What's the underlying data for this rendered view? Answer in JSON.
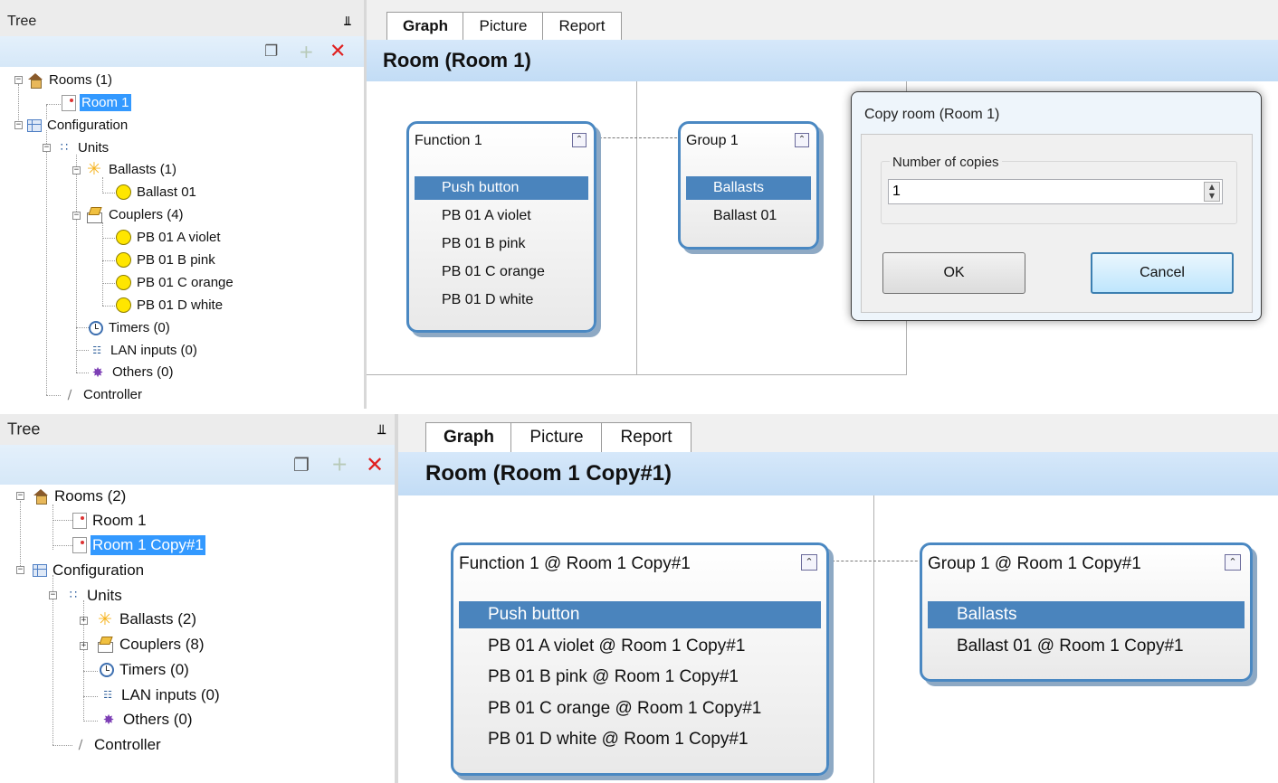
{
  "top": {
    "tree": {
      "title": "Tree",
      "nodes": {
        "rooms": "Rooms (1)",
        "room1": "Room 1",
        "configuration": "Configuration",
        "units": "Units",
        "ballasts": "Ballasts (1)",
        "ballast01": "Ballast 01",
        "couplers": "Couplers (4)",
        "pb_a": "PB 01 A violet",
        "pb_b": "PB 01 B pink",
        "pb_c": "PB 01 C orange",
        "pb_d": "PB 01 D white",
        "timers": "Timers (0)",
        "lan": "LAN inputs (0)",
        "others": "Others (0)",
        "controller": "Controller"
      }
    },
    "tabs": [
      "Graph",
      "Picture",
      "Report"
    ],
    "active_tab": "Graph",
    "title": "Room (Room 1)",
    "function_card": {
      "title": "Function 1",
      "items": [
        "Push button",
        "PB 01 A violet",
        "PB 01 B pink",
        "PB 01 C orange",
        "PB 01 D white"
      ]
    },
    "group_card": {
      "title": "Group 1",
      "items": [
        "Ballasts",
        "Ballast 01"
      ]
    },
    "dialog": {
      "title": "Copy room (Room 1)",
      "group_label": "Number of copies",
      "value": "1",
      "ok_label": "OK",
      "cancel_label": "Cancel"
    }
  },
  "bottom": {
    "tree": {
      "title": "Tree",
      "nodes": {
        "rooms": "Rooms (2)",
        "room1": "Room 1",
        "room1copy": "Room 1 Copy#1",
        "configuration": "Configuration",
        "units": "Units",
        "ballasts": "Ballasts (2)",
        "couplers": "Couplers (8)",
        "timers": "Timers (0)",
        "lan": "LAN inputs (0)",
        "others": "Others (0)",
        "controller": "Controller"
      }
    },
    "tabs": [
      "Graph",
      "Picture",
      "Report"
    ],
    "active_tab": "Graph",
    "title": "Room (Room 1 Copy#1)",
    "function_card": {
      "title": "Function 1 @ Room 1 Copy#1",
      "items": [
        "Push button",
        "PB 01 A violet @ Room 1 Copy#1",
        "PB 01 B pink @ Room 1 Copy#1",
        "PB 01 C orange @ Room 1 Copy#1",
        "PB 01 D white @ Room 1 Copy#1"
      ]
    },
    "group_card": {
      "title": "Group 1 @ Room 1 Copy#1",
      "items": [
        "Ballasts",
        "Ballast 01 @ Room 1 Copy#1"
      ]
    }
  },
  "icons": {
    "pin": "pin-icon",
    "copy": "copy-icon",
    "add": "add-icon",
    "delete": "delete-icon",
    "collapse": "collapse-icon"
  },
  "colors": {
    "selection": "#3399ff",
    "card_border": "#4a88c2",
    "item_highlight": "#4a84bd",
    "delete_red": "#e02020"
  }
}
